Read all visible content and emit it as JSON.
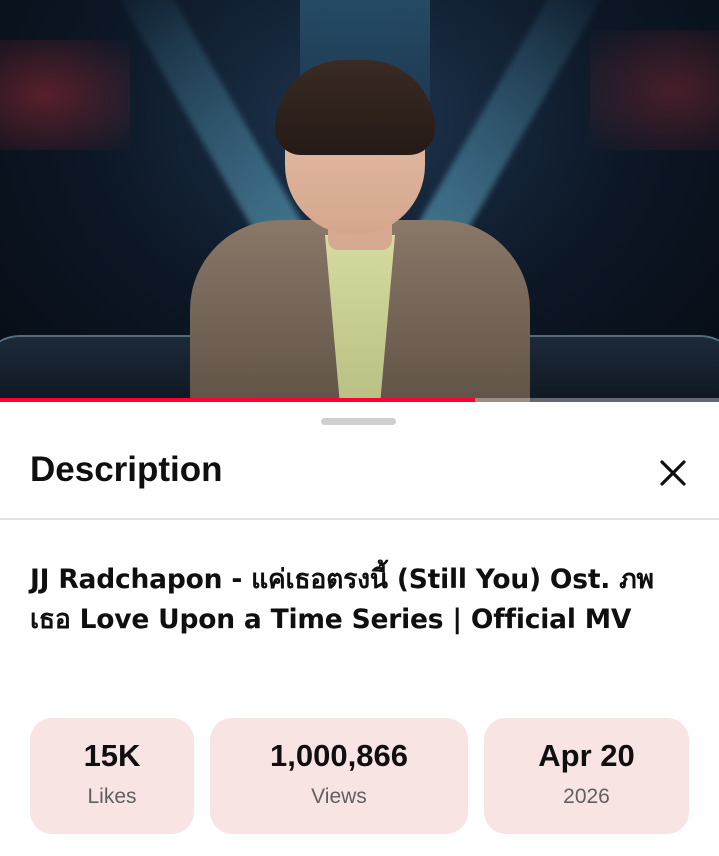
{
  "video": {
    "progress_fraction": 0.66
  },
  "sheet": {
    "title": "Description",
    "close_icon": "close-icon"
  },
  "video_title": "JJ Radchapon - แค่เธอตรงนี้ (Still You) Ost. ภพเธอ Love Upon a Time Series | Official MV",
  "stats": {
    "likes": {
      "value": "15K",
      "label": "Likes"
    },
    "views": {
      "value": "1,000,866",
      "label": "Views"
    },
    "date": {
      "value": "Apr 20",
      "label": "2026"
    }
  },
  "colors": {
    "progress": "#ff0033",
    "stat_bg": "#f9e4e4"
  }
}
